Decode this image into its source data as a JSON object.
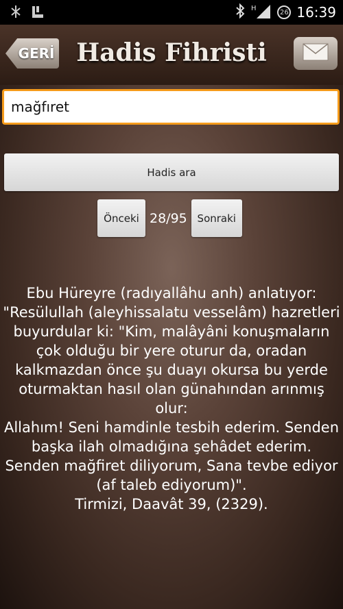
{
  "status_bar": {
    "time": "16:39",
    "left_icons": [
      "usb-debug-icon",
      "storage-icon"
    ],
    "right_icons": [
      "bluetooth-icon",
      "signal-h-icon",
      "badge-26-icon"
    ],
    "badge_number": "26",
    "network_type": "H"
  },
  "header": {
    "back_label": "GERİ",
    "title": "Hadis Fihristi",
    "mail_icon": "mail-icon"
  },
  "search": {
    "value": "mağfıret"
  },
  "search_button_label": "Hadis ara",
  "pager": {
    "prev_label": "Önceki",
    "count": "28/95",
    "next_label": "Sonraki"
  },
  "hadith": {
    "lines": [
      "Ebu Hüreyre (radıyallâhu anh) anlatıyor: \"Resülullah (aleyhissalatu vesselâm) hazretleri buyurdular ki: \"Kim, malâyâni konuşmaların çok olduğu bir yere oturur da, oradan kalkmazdan önce şu duayı okursa bu yerde oturmaktan hasıl olan günahından arınmış olur:",
      "Allahım! Seni hamdinle tesbih ederim. Senden başka ilah olmadığına şehâdet ederim. Senden mağfiret diliyorum, Sana tevbe ediyor (af taleb ediyorum)\".",
      "Tirmizi, Daavât 39, (2329)."
    ]
  },
  "colors": {
    "accent": "#f59b1b",
    "header_bg": "#3a271e",
    "text": "#ffffff"
  }
}
